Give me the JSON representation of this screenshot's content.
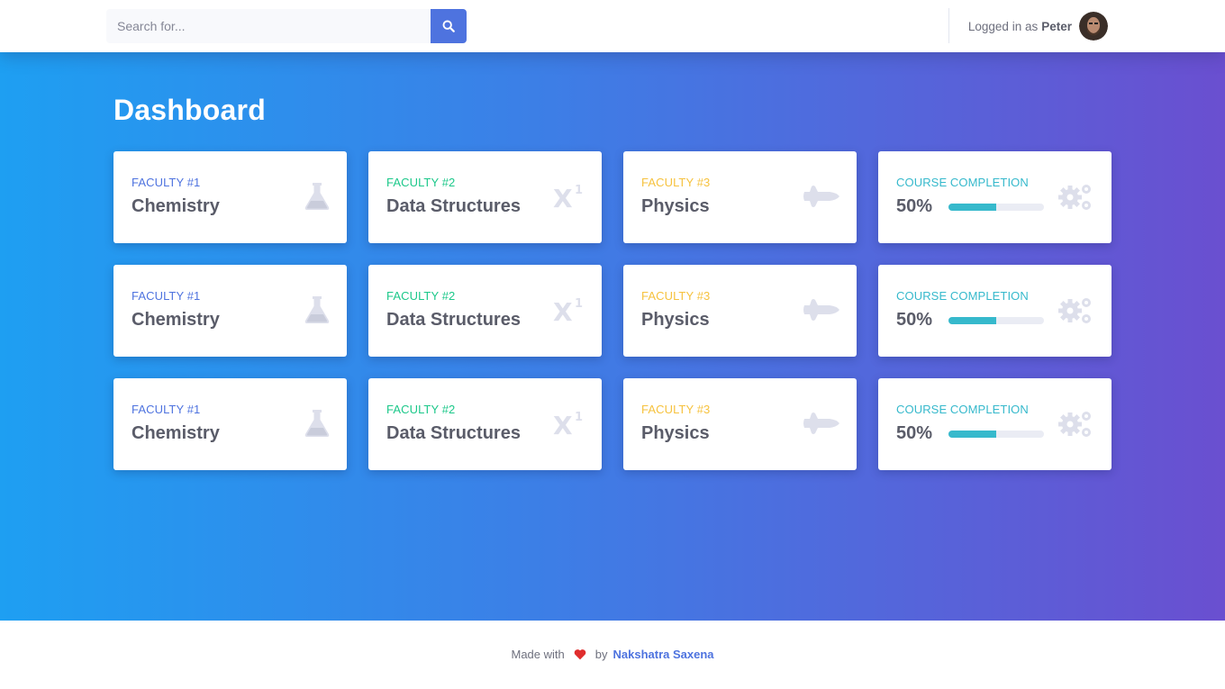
{
  "colors": {
    "primary": "#4e73df",
    "success": "#1cc88a",
    "warning": "#f6c23e",
    "info": "#36b9cc",
    "icon": "#dddfeb",
    "heart": "#e02d2d"
  },
  "topbar": {
    "search": {
      "placeholder": "Search for...",
      "button_icon": "search-icon"
    },
    "user": {
      "prefix": "Logged in as",
      "name": "Peter",
      "avatar_icon": "avatar"
    }
  },
  "page": {
    "title": "Dashboard"
  },
  "cards": [
    {
      "label": "FACULTY #1",
      "value": "Chemistry",
      "icon": "flask-icon",
      "color": "primary"
    },
    {
      "label": "FACULTY #2",
      "value": "Data Structures",
      "icon": "superscript-icon",
      "color": "success"
    },
    {
      "label": "FACULTY #3",
      "value": "Physics",
      "icon": "space-shuttle-icon",
      "color": "warning"
    },
    {
      "label": "COURSE COMPLETION",
      "value": "50%",
      "progress": 0.5,
      "icon": "cogs-icon",
      "color": "info"
    },
    {
      "label": "FACULTY #1",
      "value": "Chemistry",
      "icon": "flask-icon",
      "color": "primary"
    },
    {
      "label": "FACULTY #2",
      "value": "Data Structures",
      "icon": "superscript-icon",
      "color": "success"
    },
    {
      "label": "FACULTY #3",
      "value": "Physics",
      "icon": "space-shuttle-icon",
      "color": "warning"
    },
    {
      "label": "COURSE COMPLETION",
      "value": "50%",
      "progress": 0.5,
      "icon": "cogs-icon",
      "color": "info"
    },
    {
      "label": "FACULTY #1",
      "value": "Chemistry",
      "icon": "flask-icon",
      "color": "primary"
    },
    {
      "label": "FACULTY #2",
      "value": "Data Structures",
      "icon": "superscript-icon",
      "color": "success"
    },
    {
      "label": "FACULTY #3",
      "value": "Physics",
      "icon": "space-shuttle-icon",
      "color": "warning"
    },
    {
      "label": "COURSE COMPLETION",
      "value": "50%",
      "progress": 0.5,
      "icon": "cogs-icon",
      "color": "info"
    }
  ],
  "footer": {
    "prefix": "Made with",
    "icon": "heart-icon",
    "by": "by",
    "author": "Nakshatra Saxena"
  }
}
